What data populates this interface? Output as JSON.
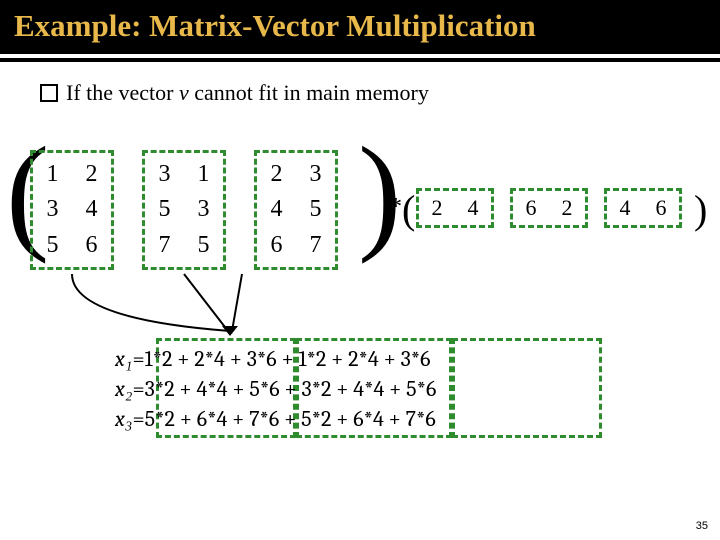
{
  "title": "Example: Matrix-Vector Multiplication",
  "bullet_text_pre": "If the vector ",
  "bullet_vec": "v",
  "bullet_text_post": " cannot fit in main memory",
  "matrix_blocks": [
    [
      [
        "1",
        "2"
      ],
      [
        "3",
        "4"
      ],
      [
        "5",
        "6"
      ]
    ],
    [
      [
        "3",
        "1"
      ],
      [
        "5",
        "3"
      ],
      [
        "7",
        "5"
      ]
    ],
    [
      [
        "2",
        "3"
      ],
      [
        "4",
        "5"
      ],
      [
        "6",
        "7"
      ]
    ]
  ],
  "star": "*",
  "vector_blocks": [
    [
      "2",
      "4"
    ],
    [
      "6",
      "2"
    ],
    [
      "4",
      "6"
    ]
  ],
  "equations": {
    "labels": [
      "x₁",
      "x₂",
      "x₃"
    ],
    "parts": [
      [
        "1*2 + 2*4",
        "3*6 + 1*2",
        "2*4 + 3*6"
      ],
      [
        "3*2 + 4*4",
        "5*6 + 3*2",
        "4*4 + 5*6"
      ],
      [
        "5*2 + 6*4",
        "7*6 + 5*2",
        "6*4 + 7*6"
      ]
    ]
  },
  "page_number": "35"
}
